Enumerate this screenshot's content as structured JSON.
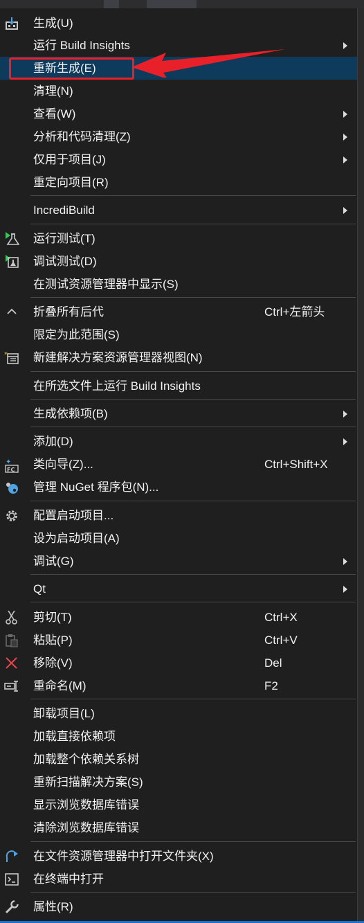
{
  "menu": {
    "items": [
      {
        "label": "生成(U)",
        "shortcut": "",
        "submenu": false,
        "icon": "build-icon",
        "highlighted": false
      },
      {
        "label": "运行 Build Insights",
        "shortcut": "",
        "submenu": true,
        "icon": "",
        "highlighted": false
      },
      {
        "label": "重新生成(E)",
        "shortcut": "",
        "submenu": false,
        "icon": "",
        "highlighted": true
      },
      {
        "label": "清理(N)",
        "shortcut": "",
        "submenu": false,
        "icon": "",
        "highlighted": false
      },
      {
        "label": "查看(W)",
        "shortcut": "",
        "submenu": true,
        "icon": "",
        "highlighted": false
      },
      {
        "label": "分析和代码清理(Z)",
        "shortcut": "",
        "submenu": true,
        "icon": "",
        "highlighted": false
      },
      {
        "label": "仅用于项目(J)",
        "shortcut": "",
        "submenu": true,
        "icon": "",
        "highlighted": false
      },
      {
        "label": "重定向项目(R)",
        "shortcut": "",
        "submenu": false,
        "icon": "",
        "highlighted": false
      },
      {
        "label": "IncrediBuild",
        "shortcut": "",
        "submenu": true,
        "icon": "",
        "highlighted": false
      },
      {
        "label": "运行测试(T)",
        "shortcut": "",
        "submenu": false,
        "icon": "run-test-flask-icon",
        "highlighted": false
      },
      {
        "label": "调试测试(D)",
        "shortcut": "",
        "submenu": false,
        "icon": "debug-test-flask-icon",
        "highlighted": false
      },
      {
        "label": "在测试资源管理器中显示(S)",
        "shortcut": "",
        "submenu": false,
        "icon": "",
        "highlighted": false
      },
      {
        "label": "折叠所有后代",
        "shortcut": "Ctrl+左箭头",
        "submenu": false,
        "icon": "chevron-up-icon",
        "highlighted": false
      },
      {
        "label": "限定为此范围(S)",
        "shortcut": "",
        "submenu": false,
        "icon": "",
        "highlighted": false
      },
      {
        "label": "新建解决方案资源管理器视图(N)",
        "shortcut": "",
        "submenu": false,
        "icon": "new-view-icon",
        "highlighted": false
      },
      {
        "label": "在所选文件上运行 Build Insights",
        "shortcut": "",
        "submenu": false,
        "icon": "",
        "highlighted": false
      },
      {
        "label": "生成依赖项(B)",
        "shortcut": "",
        "submenu": true,
        "icon": "",
        "highlighted": false
      },
      {
        "label": "添加(D)",
        "shortcut": "",
        "submenu": true,
        "icon": "",
        "highlighted": false
      },
      {
        "label": "类向导(Z)...",
        "shortcut": "Ctrl+Shift+X",
        "submenu": false,
        "icon": "class-wizard-icon",
        "highlighted": false
      },
      {
        "label": "管理 NuGet 程序包(N)...",
        "shortcut": "",
        "submenu": false,
        "icon": "nuget-icon",
        "highlighted": false
      },
      {
        "label": "配置启动项目...",
        "shortcut": "",
        "submenu": false,
        "icon": "gear-icon",
        "highlighted": false
      },
      {
        "label": "设为启动项目(A)",
        "shortcut": "",
        "submenu": false,
        "icon": "",
        "highlighted": false
      },
      {
        "label": "调试(G)",
        "shortcut": "",
        "submenu": true,
        "icon": "",
        "highlighted": false
      },
      {
        "label": "Qt",
        "shortcut": "",
        "submenu": true,
        "icon": "",
        "highlighted": false
      },
      {
        "label": "剪切(T)",
        "shortcut": "Ctrl+X",
        "submenu": false,
        "icon": "scissors-icon",
        "highlighted": false
      },
      {
        "label": "粘贴(P)",
        "shortcut": "Ctrl+V",
        "submenu": false,
        "icon": "paste-icon",
        "highlighted": false
      },
      {
        "label": "移除(V)",
        "shortcut": "Del",
        "submenu": false,
        "icon": "close-icon",
        "highlighted": false
      },
      {
        "label": "重命名(M)",
        "shortcut": "F2",
        "submenu": false,
        "icon": "rename-icon",
        "highlighted": false
      },
      {
        "label": "卸载项目(L)",
        "shortcut": "",
        "submenu": false,
        "icon": "",
        "highlighted": false
      },
      {
        "label": "加载直接依赖项",
        "shortcut": "",
        "submenu": false,
        "icon": "",
        "highlighted": false
      },
      {
        "label": "加载整个依赖关系树",
        "shortcut": "",
        "submenu": false,
        "icon": "",
        "highlighted": false
      },
      {
        "label": "重新扫描解决方案(S)",
        "shortcut": "",
        "submenu": false,
        "icon": "",
        "highlighted": false
      },
      {
        "label": "显示浏览数据库错误",
        "shortcut": "",
        "submenu": false,
        "icon": "",
        "highlighted": false
      },
      {
        "label": "清除浏览数据库错误",
        "shortcut": "",
        "submenu": false,
        "icon": "",
        "highlighted": false
      },
      {
        "label": "在文件资源管理器中打开文件夹(X)",
        "shortcut": "",
        "submenu": false,
        "icon": "open-folder-arrow-icon",
        "highlighted": false
      },
      {
        "label": "在终端中打开",
        "shortcut": "",
        "submenu": false,
        "icon": "terminal-icon",
        "highlighted": false
      },
      {
        "label": "属性(R)",
        "shortcut": "",
        "submenu": false,
        "icon": "wrench-icon",
        "highlighted": false
      }
    ]
  },
  "colors": {
    "menu_background": "#1f1f1f",
    "highlight": "#0e3a5c",
    "annotation_red": "#e8202a",
    "text": "#f1f1f1"
  }
}
